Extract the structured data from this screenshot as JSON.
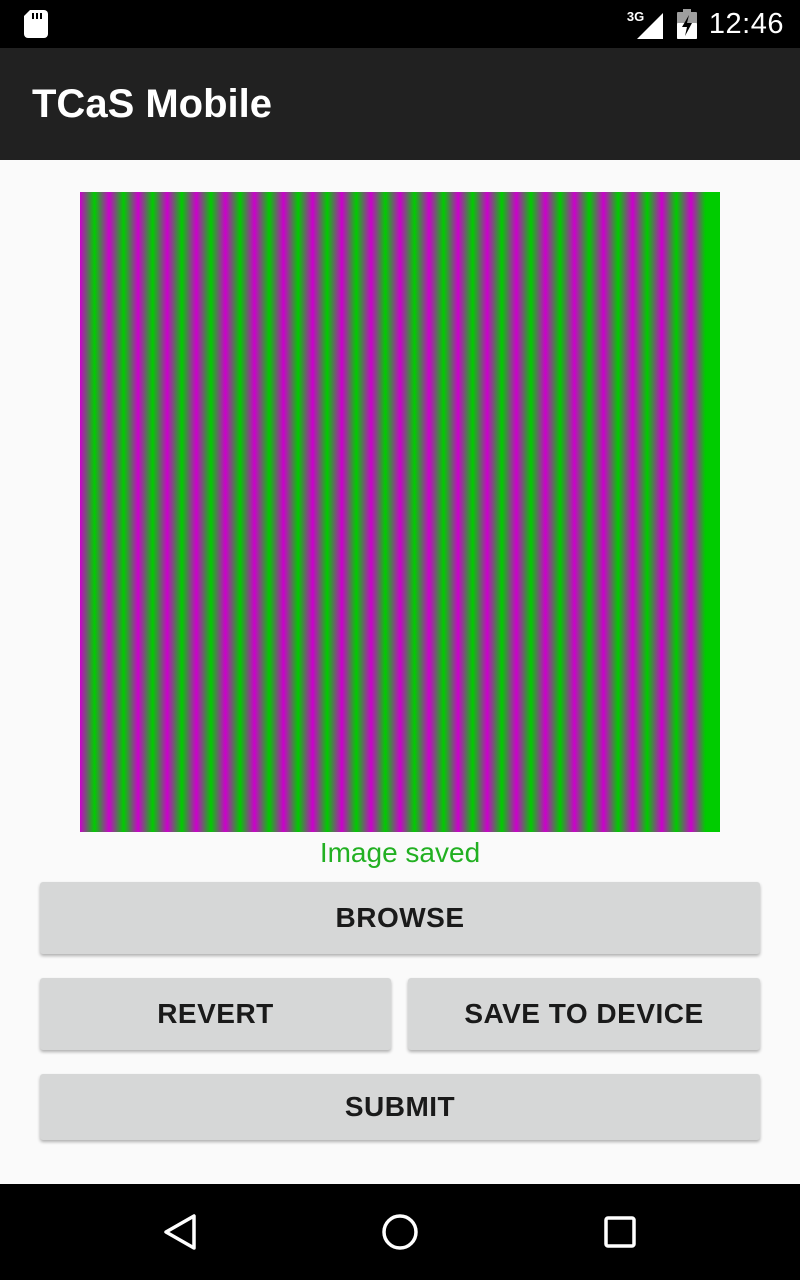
{
  "status_bar": {
    "time": "12:46",
    "network_label": "3G",
    "icons": [
      "sd-card-icon",
      "signal-3g-icon",
      "battery-charging-icon"
    ]
  },
  "app_bar": {
    "title": "TCaS Mobile"
  },
  "preview": {
    "pattern": "vertical-stripes",
    "colors": [
      "#cc00cc",
      "#00cc00"
    ],
    "stripe_count": 22
  },
  "status_message": {
    "text": "Image saved",
    "color": "#22b022"
  },
  "buttons": {
    "browse": "BROWSE",
    "revert": "REVERT",
    "save_to_device": "SAVE TO DEVICE",
    "submit": "SUBMIT"
  },
  "nav_bar": {
    "icons": [
      "back-icon",
      "home-icon",
      "recents-icon"
    ]
  }
}
